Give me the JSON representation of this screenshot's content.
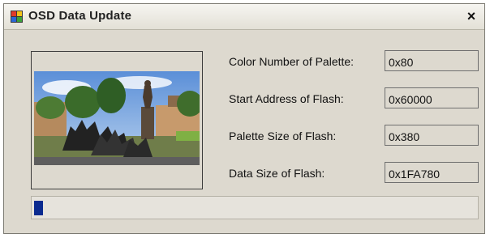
{
  "window": {
    "title": "OSD Data Update",
    "close_glyph": "×",
    "icon": "app-icon"
  },
  "preview": {
    "image": "photo-of-statue-in-square"
  },
  "fields": [
    {
      "label": "Color Number of Palette:",
      "value": "0x80"
    },
    {
      "label": "Start Address of Flash:",
      "value": "0x60000"
    },
    {
      "label": "Palette Size of Flash:",
      "value": "0x380"
    },
    {
      "label": "Data Size of Flash:",
      "value": "0x1FA780"
    }
  ],
  "progress": {
    "fraction": 0.02,
    "color": "#0a2a8f"
  },
  "colors": {
    "window_background": "#ddd9cf"
  }
}
